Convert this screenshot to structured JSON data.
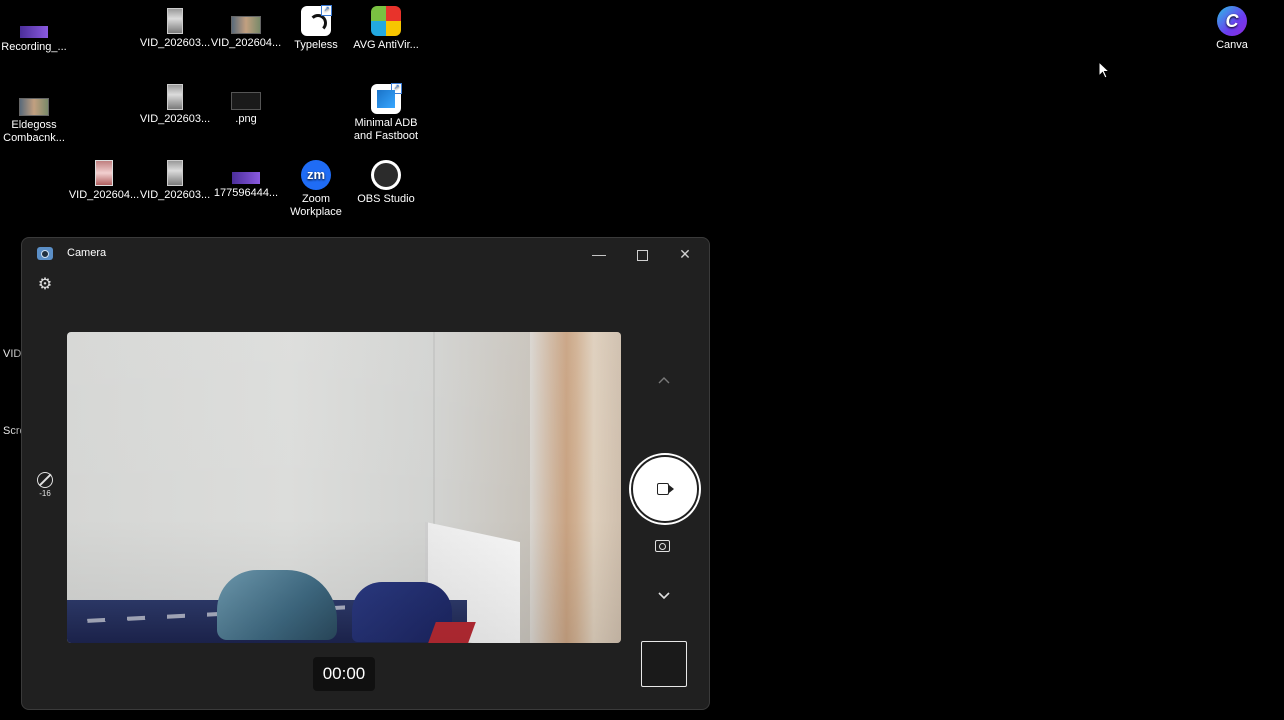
{
  "desktop": {
    "icons": [
      {
        "label": "Recording_...",
        "icon": "video-thumbnail-icon"
      },
      {
        "label": "VID_202603...",
        "icon": "video-thumbnail-icon"
      },
      {
        "label": "VID_202604...",
        "icon": "video-thumbnail-icon"
      },
      {
        "label": "Typeless",
        "icon": "typeless-app-icon"
      },
      {
        "label": "AVG AntiVir...",
        "icon": "avg-antivirus-icon"
      },
      {
        "label": "Canva",
        "icon": "canva-icon"
      },
      {
        "label": "Eldegoss Combacnk...",
        "icon": "image-thumbnail-icon"
      },
      {
        "label": "VID_202603...",
        "icon": "video-thumbnail-icon"
      },
      {
        "label": ".png",
        "icon": "image-thumbnail-icon"
      },
      {
        "label": "Minimal ADB and Fastboot",
        "icon": "adb-icon"
      },
      {
        "label": "VID_202604...",
        "icon": "video-thumbnail-icon"
      },
      {
        "label": "VID_202603...",
        "icon": "video-thumbnail-icon"
      },
      {
        "label": "177596444...",
        "icon": "image-thumbnail-icon"
      },
      {
        "label": "Zoom Workplace",
        "icon": "zoom-icon"
      },
      {
        "label": "OBS Studio",
        "icon": "obs-icon"
      }
    ],
    "partial_labels": [
      "VID_",
      "Scre"
    ]
  },
  "camera": {
    "title": "Camera",
    "controls": {
      "minimize": "—",
      "close": "✕"
    },
    "exposure_value": "-16",
    "timer": "00:00",
    "mode": "video"
  },
  "colors": {
    "window_bg": "#202020",
    "desktop_bg": "#000000",
    "zoom_blue": "#1f6cf5"
  }
}
